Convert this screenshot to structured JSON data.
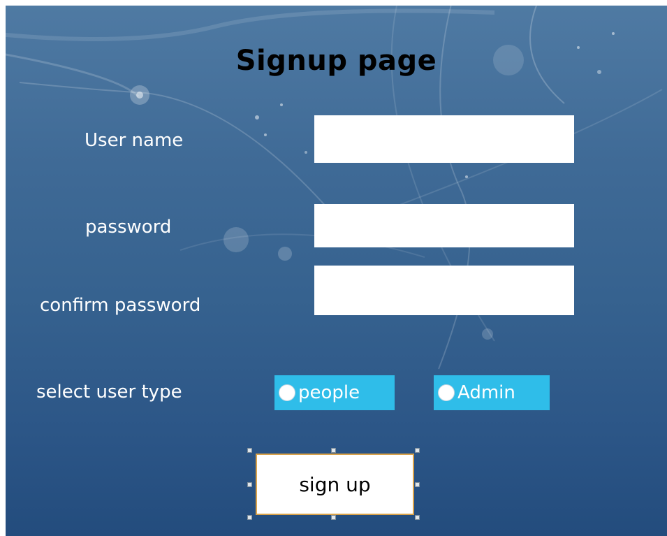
{
  "page": {
    "title": "Signup page"
  },
  "form": {
    "username_label": "User name",
    "username_value": "",
    "password_label": "password",
    "password_value": "",
    "confirm_label": "confirm password",
    "confirm_value": "",
    "user_type_label": "select user type",
    "user_type_options": [
      "people",
      "Admin"
    ],
    "signup_label": "sign up"
  },
  "colors": {
    "background_top": "#4f7aa3",
    "background_bottom": "#234c7d",
    "radio_background": "#2fbde9",
    "button_border": "#d9a24a",
    "title_text": "#000000",
    "label_text": "#ffffff"
  }
}
